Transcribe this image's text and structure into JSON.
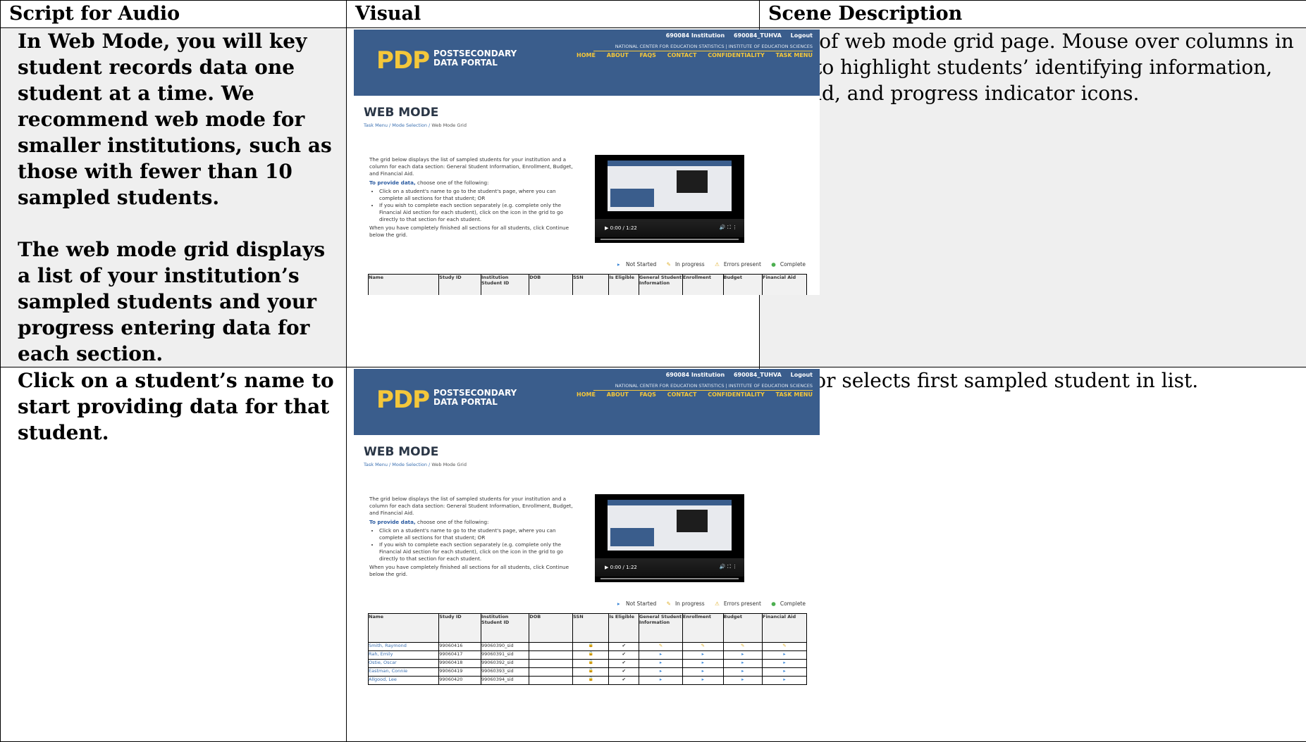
{
  "headers": {
    "script": "Script for Audio",
    "visual": "Visual",
    "scene": "Scene Description"
  },
  "rows": [
    {
      "script": [
        "In Web Mode, you will key student records data one student at a time. We recommend web mode for smaller institutions, such as those with fewer than 10 sampled students.",
        "The web mode grid displays a list of your institution’s sampled students and your progress entering data for each section."
      ],
      "scene": "Shot of web mode grid page. Mouse over columns in grid to highlight students’ identifying information, legend, and progress indicator icons."
    },
    {
      "script": [
        "Click on a student’s name to start providing data for that student."
      ],
      "scene": "Cursor selects first sampled student in list."
    }
  ],
  "portal": {
    "logo_mark": "PDP",
    "logo_line1": "POSTSECONDARY",
    "logo_line2": "DATA PORTAL",
    "institution": "690084 Institution",
    "inst_code": "690084_TUHVA",
    "logout": "Logout",
    "agencies": "NATIONAL CENTER FOR EDUCATION STATISTICS   |   INSTITUTE OF EDUCATION SCIENCES",
    "nav": [
      "HOME",
      "ABOUT",
      "FAQS",
      "CONTACT",
      "CONFIDENTIALITY",
      "TASK MENU"
    ],
    "page_title": "WEB MODE",
    "breadcrumb_links": "Task Menu / Mode Selection / ",
    "breadcrumb_current": "Web Mode Grid",
    "intro_1": "The grid below displays the list of sampled students for your institution and a column for each data section: General Student Information, Enrollment, Budget, and Financial Aid.",
    "intro_label": "To provide data,",
    "intro_label_rest": " choose one of the following:",
    "bullets": [
      "Click on a student's name to go to the student's page, where you can complete all sections for that student; OR",
      "If you wish to complete each section separately (e.g. complete only the Financial Aid section for each student), click on the icon in the grid to go directly to that section for each student."
    ],
    "intro_end": "When you have completely finished all sections for all students, click Continue below the grid.",
    "video_time": "0:00 / 1:22",
    "legend": [
      "Not Started",
      "In progress",
      "Errors present",
      "Complete"
    ],
    "columns": [
      "Name",
      "Study ID",
      "Institution Student ID",
      "DOB",
      "SSN",
      "Is Eligible",
      "General Student Information",
      "Enrollment",
      "Budget",
      "Financial Aid"
    ],
    "students": [
      [
        "Smith, Raymond",
        "99060416",
        "99060390_sid"
      ],
      [
        "Rah, Emily",
        "99060417",
        "99060391_sid"
      ],
      [
        "Ostie, Oscar",
        "99060418",
        "99060392_sid"
      ],
      [
        "Eastman, Connie",
        "99060419",
        "99060393_sid"
      ],
      [
        "Allgood, Lee",
        "99060420",
        "99060394_sid"
      ]
    ]
  }
}
